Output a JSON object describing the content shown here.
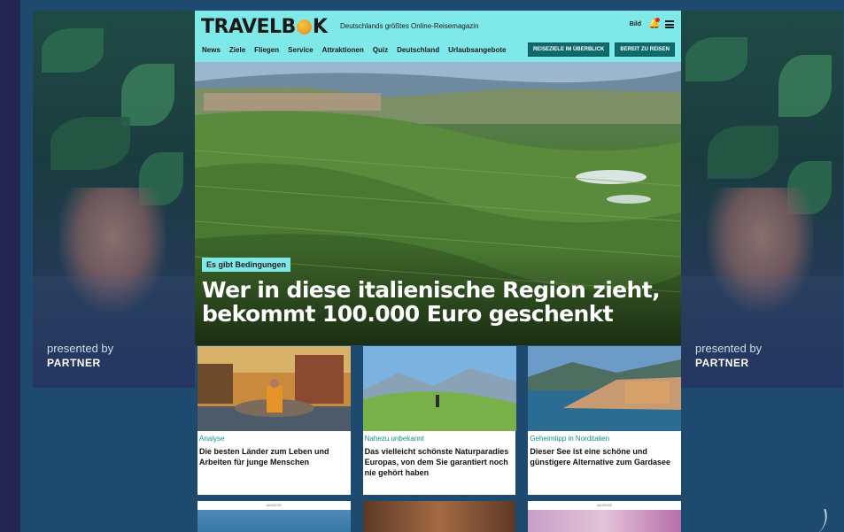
{
  "side_ad": {
    "presented_by": "presented by",
    "partner": "PARTNER"
  },
  "header": {
    "logo": {
      "pre": "TRAVELB",
      "post": "K"
    },
    "tagline": "Deutschlands größtes Online-Reisemagazin",
    "bild_label": "Bild",
    "icons": [
      "bild-icon",
      "bell-icon",
      "hamburger-icon"
    ],
    "nav": [
      "News",
      "Ziele",
      "Fliegen",
      "Service",
      "Attraktionen",
      "Quiz",
      "Deutschland",
      "Urlaubsangebote"
    ],
    "buttons": [
      "REISEZIELE IM ÜBERBLICK",
      "BEREIT ZU REISEN"
    ]
  },
  "hero": {
    "badge": "Es gibt Bedingungen",
    "title": "Wer in diese italienische Region zieht, bekommt 100.000 Euro geschenkt"
  },
  "cards": [
    {
      "kicker": "Analyse",
      "title": "Die besten Länder zum Leben und Arbeiten für junge Menschen"
    },
    {
      "kicker": "Nahezu unbekannt",
      "title": "Das vielleicht schönste Naturparadies Europas, von dem Sie garantiert noch nie gehört haben"
    },
    {
      "kicker": "Geheimtipp in Norditalien",
      "title": "Dieser See ist eine schöne und günstigere Alternative zum Gardasee"
    }
  ],
  "ads": {
    "label": "ANZEIGE"
  },
  "colors": {
    "accent": "#7fe8e8",
    "nav_button": "#0e6b6b",
    "kicker": "#0e8f8a",
    "background": "#1d4a6e"
  }
}
